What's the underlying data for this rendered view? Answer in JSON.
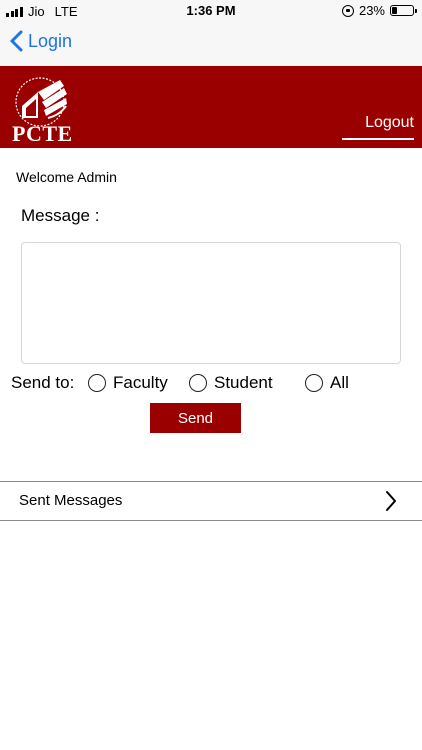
{
  "status_bar": {
    "carrier": "Jio",
    "network": "LTE",
    "time": "1:36 PM",
    "battery": "23%",
    "battery_level": 0.23
  },
  "nav": {
    "back_label": "Login",
    "accent_color": "#1a73e8"
  },
  "header": {
    "logo_text": "PCTE",
    "logout_label": "Logout",
    "brand_color": "#9a0000"
  },
  "main": {
    "welcome": "Welcome Admin",
    "message_label": "Message :",
    "message_value": "",
    "send_to_label": "Send  to:",
    "recipients": [
      "Faculty",
      "Student",
      "All"
    ],
    "send_label": "Send"
  },
  "sent_messages": {
    "label": "Sent Messages"
  }
}
